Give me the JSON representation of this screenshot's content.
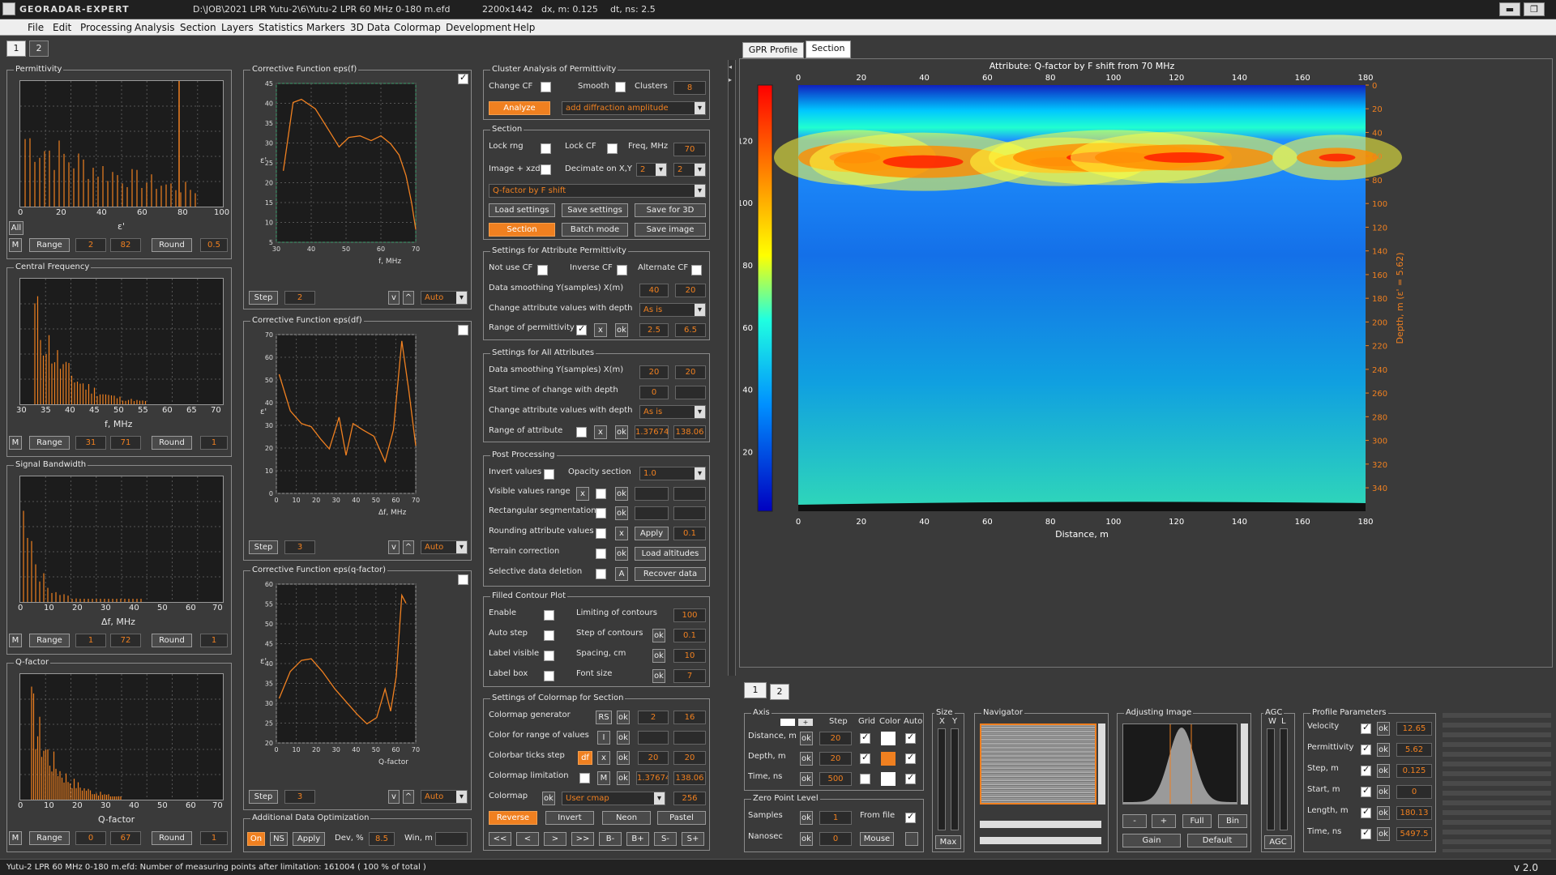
{
  "app": {
    "name": "GEORADAR-EXPERT",
    "path": "D:\\JOB\\2021 LPR Yutu-2\\6\\Yutu-2 LPR 60 MHz 0-180 m.efd",
    "size": "2200x1442",
    "dxm": "dx, m: 0.125",
    "dtns": "dt, ns: 2.5",
    "version": "v 2.0"
  },
  "menu": [
    "File",
    "Edit",
    "Processing",
    "Analysis",
    "Section",
    "Layers",
    "Statistics",
    "Markers",
    "3D Data",
    "Colormap",
    "Development",
    "Help"
  ],
  "tabs_left": [
    "1",
    "2"
  ],
  "tabs_right": [
    "GPR Profile",
    "Section"
  ],
  "tabs_bottom": [
    "1",
    "2"
  ],
  "histos": [
    {
      "title": "Permittivity",
      "xlabel": "ε'",
      "ticks": [
        "0",
        "20",
        "40",
        "60",
        "80",
        "100"
      ],
      "range_from": "2",
      "range_to": "82",
      "round": "0.5",
      "all": "All"
    },
    {
      "title": "Central Frequency",
      "xlabel": "f, MHz",
      "ticks": [
        "30",
        "35",
        "40",
        "45",
        "50",
        "55",
        "60",
        "65",
        "70"
      ],
      "range_from": "31",
      "range_to": "71",
      "round": "1"
    },
    {
      "title": "Signal Bandwidth",
      "xlabel": "Δf, MHz",
      "ticks": [
        "0",
        "10",
        "20",
        "30",
        "40",
        "50",
        "60",
        "70"
      ],
      "range_from": "1",
      "range_to": "72",
      "round": "1"
    },
    {
      "title": "Q-factor",
      "xlabel": "Q-factor",
      "ticks": [
        "0",
        "10",
        "20",
        "30",
        "40",
        "50",
        "60",
        "70"
      ],
      "range_from": "0",
      "range_to": "67",
      "round": "1"
    }
  ],
  "common": {
    "m": "M",
    "range": "Range",
    "round": "Round",
    "step": "Step",
    "auto": "Auto",
    "v": "v",
    "up": "^"
  },
  "cf": [
    {
      "title": "Corrective Function eps(f)",
      "xlabel": "f, MHz",
      "ylabel": "ε'",
      "xt": [
        "30",
        "40",
        "50",
        "60",
        "70"
      ],
      "yt": [
        "45",
        "40",
        "35",
        "30",
        "25",
        "20",
        "15",
        "10",
        "5"
      ],
      "step": "2",
      "checked": true
    },
    {
      "title": "Corrective Function eps(df)",
      "xlabel": "Δf, MHz",
      "ylabel": "ε'",
      "xt": [
        "0",
        "10",
        "20",
        "30",
        "40",
        "50",
        "60",
        "70"
      ],
      "yt": [
        "70",
        "60",
        "50",
        "40",
        "30",
        "20",
        "10",
        "0"
      ],
      "step": "3",
      "checked": false
    },
    {
      "title": "Corrective Function eps(q-factor)",
      "xlabel": "Q-factor",
      "ylabel": "ε'",
      "xt": [
        "0",
        "10",
        "20",
        "30",
        "40",
        "50",
        "60",
        "70"
      ],
      "yt": [
        "60",
        "55",
        "50",
        "45",
        "40",
        "35",
        "30",
        "25",
        "20"
      ],
      "step": "3",
      "checked": false
    }
  ],
  "optim": {
    "title": "Additional Data Optimization",
    "on": "On",
    "ns": "NS",
    "apply": "Apply",
    "dev": "Dev, %",
    "dev_val": "8.5",
    "win": "Win, m"
  },
  "cluster": {
    "title": "Cluster Analysis of Permittivity",
    "change_cf": "Change CF",
    "smooth": "Smooth",
    "clusters": "Clusters",
    "clusters_val": "8",
    "analyze": "Analyze",
    "mode": "add diffraction amplitude"
  },
  "section": {
    "title": "Section",
    "lock_rng": "Lock rng",
    "lock_cf": "Lock CF",
    "freq": "Freq, MHz",
    "freq_val": "70",
    "image_xzd": "Image + xzd",
    "decimate": "Decimate on X,Y",
    "dec_x": "2",
    "dec_y": "2",
    "attr": "Q-factor by F shift",
    "load": "Load settings",
    "save": "Save settings",
    "save3d": "Save for 3D",
    "section_btn": "Section",
    "batch": "Batch mode",
    "save_img": "Save image"
  },
  "attrperm": {
    "title": "Settings for Attribute Permittivity",
    "not_use_cf": "Not use CF",
    "inverse_cf": "Inverse CF",
    "alternate_cf": "Alternate CF",
    "smoothing": "Data smoothing  Y(samples)  X(m)",
    "sy": "40",
    "sx": "20",
    "change": "Change attribute values with depth",
    "asis": "As is",
    "range": "Range of permittivity",
    "x": "x",
    "ok": "ok",
    "r1": "2.5",
    "r2": "6.5"
  },
  "allattr": {
    "title": "Settings for All Attributes",
    "smoothing": "Data smoothing  Y(samples)  X(m)",
    "sy": "20",
    "sx": "20",
    "start": "Start time of change with depth",
    "start_val": "0",
    "change": "Change attribute values with depth",
    "asis": "As is",
    "range": "Range of attribute",
    "r1": "1.37674",
    "r2": "138.06"
  },
  "post": {
    "title": "Post Processing",
    "invert": "Invert values",
    "opacity": "Opacity section",
    "opacity_val": "1.0",
    "visible": "Visible values range",
    "rect": "Rectangular segmentation",
    "rounding": "Rounding attribute values",
    "apply": "Apply",
    "round_val": "0.1",
    "terrain": "Terrain correction",
    "load_alt": "Load altitudes",
    "selective": "Selective data deletion",
    "a": "A",
    "recover": "Recover data"
  },
  "contour": {
    "title": "Filled Contour Plot",
    "enable": "Enable",
    "limit": "Limiting of contours",
    "limit_val": "100",
    "auto_step": "Auto step",
    "step": "Step of contours",
    "step_val": "0.1",
    "label_vis": "Label visible",
    "spacing": "Spacing, cm",
    "spacing_val": "10",
    "label_box": "Label box",
    "font": "Font size",
    "font_val": "7"
  },
  "colormap": {
    "title": "Settings of Colormap for Section",
    "gen": "Colormap generator",
    "rs": "RS",
    "g1": "2",
    "g2": "16",
    "crange": "Color for range of values",
    "i": "I",
    "ticks": "Colorbar ticks step",
    "df": "df",
    "t1": "20",
    "t2": "20",
    "limit": "Colormap limitation",
    "l1": "1.37674",
    "l2": "138.06",
    "cmap": "Colormap",
    "user": "User cmap",
    "n": "256",
    "reverse": "Reverse",
    "invert": "Invert",
    "neon": "Neon",
    "pastel": "Pastel",
    "nav": [
      "<<",
      "<",
      ">",
      ">>",
      "B-",
      "B+",
      "S-",
      "S+"
    ]
  },
  "section_plot": {
    "title": "Attribute:  Q-factor by F shift from 70 MHz",
    "xlabel": "Distance, m",
    "ylabel": "Depth, m (ε' = 5.62)",
    "xticks": [
      "0",
      "20",
      "40",
      "60",
      "80",
      "100",
      "120",
      "140",
      "160",
      "180"
    ],
    "yticks_right": [
      "0",
      "20",
      "40",
      "60",
      "80",
      "100",
      "120",
      "140",
      "160",
      "180",
      "200",
      "220",
      "240",
      "260",
      "280",
      "300",
      "320",
      "340"
    ],
    "cbar_ticks": [
      "120",
      "100",
      "80",
      "60",
      "40",
      "20"
    ]
  },
  "axis": {
    "title": "Axis",
    "step": "Step",
    "grid": "Grid",
    "color": "Color",
    "auto": "Auto",
    "distance": "Distance, m",
    "depth": "Depth, m",
    "time": "Time, ns",
    "d_val": "20",
    "dp_val": "20",
    "t_val": "500"
  },
  "size": {
    "title": "Size",
    "x": "X",
    "y": "Y",
    "max": "Max"
  },
  "navigator": {
    "title": "Navigator"
  },
  "adjust": {
    "title": "Adjusting Image",
    "minus": "-",
    "plus": "+",
    "full": "Full",
    "bin": "Bin",
    "gain": "Gain",
    "default": "Default"
  },
  "agc": {
    "title": "AGC",
    "w": "W",
    "l": "L",
    "agc": "AGC"
  },
  "zero": {
    "title": "Zero Point Level",
    "samples": "Samples",
    "samples_val": "1",
    "from_file": "From file",
    "nanosec": "Nanosec",
    "nanosec_val": "0",
    "mouse": "Mouse"
  },
  "profile": {
    "title": "Profile Parameters",
    "velocity": "Velocity",
    "velocity_val": "12.65",
    "perm": "Permittivity",
    "perm_val": "5.62",
    "step": "Step, m",
    "step_val": "0.125",
    "start": "Start, m",
    "start_val": "0",
    "length": "Length, m",
    "length_val": "180.13",
    "time": "Time, ns",
    "time_val": "5497.5"
  },
  "status": {
    "text": "Yutu-2 LPR 60 MHz 0-180 m.efd:    Number of measuring points after limitation: 161004  ( 100 % of total )"
  },
  "colors": {
    "accent": "#f08020",
    "bg": "#3a3a3a"
  }
}
